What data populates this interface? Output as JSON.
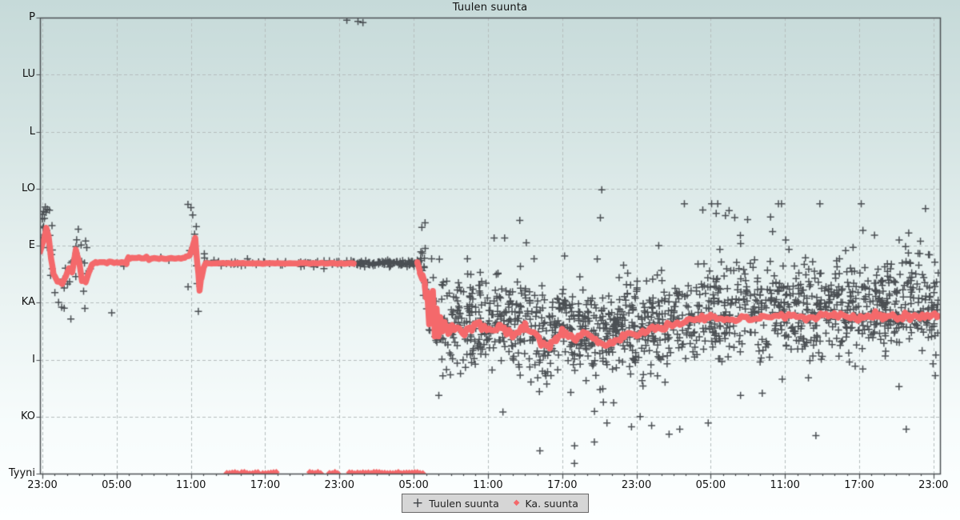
{
  "chart_data": {
    "type": "scatter",
    "title": "Tuulen suunta",
    "legend_position": "bottom-center",
    "grid": {
      "style": "dashed",
      "h_degrees": [
        315,
        270,
        225,
        180,
        135,
        90,
        45
      ],
      "v_hours": [
        0,
        6,
        12,
        18,
        24,
        30,
        36,
        42,
        48,
        54,
        60,
        66,
        72
      ]
    },
    "x_axis": {
      "unit": "time",
      "range_hours": [
        -0.19,
        72.55
      ],
      "tick_hours": [
        0,
        6,
        12,
        18,
        24,
        30,
        36,
        42,
        48,
        54,
        60,
        66,
        72
      ],
      "tick_labels": [
        "23:00",
        "05:00",
        "11:00",
        "17:00",
        "23:00",
        "05:00",
        "11:00",
        "17:00",
        "23:00",
        "05:00",
        "11:00",
        "17:00",
        "23:00"
      ],
      "minor_tick_hours": 1
    },
    "y_axis": {
      "unit": "wind direction, compass points (degrees), Tyyni = calm",
      "range_degrees": [
        0,
        360
      ],
      "tick_degrees": [
        360,
        315,
        270,
        225,
        180,
        135,
        90,
        45,
        0
      ],
      "tick_labels": [
        "P",
        "LU",
        "L",
        "LO",
        "E",
        "KA",
        "I",
        "KO",
        "Tyyni"
      ]
    },
    "series": [
      {
        "name": "Tuulen suunta",
        "marker": "plus",
        "color": "#3d4145",
        "generated_segments": [
          {
            "t0": -0.15,
            "t1": 0.9,
            "n": 16,
            "sd": 20,
            "bias": 6
          },
          {
            "t0": 0.9,
            "t1": 3.6,
            "n": 26,
            "sd": 15,
            "bias": 2
          },
          {
            "t0": 3.6,
            "t1": 11.6,
            "n": 4,
            "sd": 3,
            "bias": 0
          },
          {
            "t0": 11.7,
            "t1": 13.1,
            "n": 9,
            "sd": 26,
            "bias": 4
          },
          {
            "t0": 13.0,
            "t1": 25.15,
            "n": 60,
            "sd": 1.4,
            "bias": 0,
            "center": 166
          },
          {
            "t0": 25.15,
            "t1": 30.45,
            "n": 90,
            "sd": 1.1,
            "bias": 0,
            "center": 166
          },
          {
            "t0": 30.5,
            "t1": 33.0,
            "n": 60,
            "sd": 21,
            "bias": 4
          },
          {
            "t0": 33.0,
            "t1": 72.4,
            "n": 1500,
            "sd": 18,
            "bias": 6,
            "tail_frac": 0.09,
            "tail_sd": 44
          }
        ],
        "outlier_points": [
          [
            0.1,
            207
          ],
          [
            0.0,
            201
          ],
          [
            0.35,
            192
          ],
          [
            0.6,
            188
          ],
          [
            2.3,
            122
          ],
          [
            5.6,
            127
          ],
          [
            2.9,
            193
          ],
          [
            12.0,
            210
          ],
          [
            12.3,
            189
          ],
          [
            12.5,
            150
          ],
          [
            12.6,
            128
          ],
          [
            11.9,
            176
          ],
          [
            24.6,
            358
          ],
          [
            25.5,
            357
          ],
          [
            25.9,
            356
          ],
          [
            36.5,
            186
          ],
          [
            45.2,
            224
          ],
          [
            43.0,
            22
          ],
          [
            47.6,
            37
          ],
          [
            40.2,
            18
          ],
          [
            44.6,
            25
          ],
          [
            48.3,
            45
          ],
          [
            49.8,
            180
          ],
          [
            51.5,
            35
          ],
          [
            53.8,
            40
          ],
          [
            56.4,
            188
          ],
          [
            59.0,
            191
          ],
          [
            62.5,
            30
          ],
          [
            66.3,
            192
          ],
          [
            69.8,
            35
          ],
          [
            70.0,
            190
          ]
        ]
      },
      {
        "name": "Ka. suunta",
        "marker": "diamond",
        "color": "#f4696b",
        "line_parts": [
          [
            [
              -0.19,
              176
            ],
            [
              0.15,
              185
            ],
            [
              0.32,
              194
            ],
            [
              0.5,
              188
            ],
            [
              0.7,
              170
            ],
            [
              0.9,
              158
            ],
            [
              1.2,
              152
            ],
            [
              1.6,
              150
            ],
            [
              1.9,
              156
            ],
            [
              2.15,
              162
            ],
            [
              2.4,
              158
            ],
            [
              2.7,
              177
            ],
            [
              2.95,
              168
            ],
            [
              3.2,
              152
            ],
            [
              3.5,
              151
            ],
            [
              3.75,
              158
            ],
            [
              4.0,
              165
            ],
            [
              4.3,
              166.5
            ],
            [
              6.8,
              166.5
            ],
            [
              6.95,
              170
            ],
            [
              11.5,
              170
            ],
            [
              11.9,
              172
            ],
            [
              12.1,
              178
            ],
            [
              12.35,
              186
            ],
            [
              12.5,
              168
            ],
            [
              12.7,
              146
            ],
            [
              12.85,
              155
            ],
            [
              13.0,
              162
            ],
            [
              13.2,
              166
            ],
            [
              25.15,
              166
            ]
          ],
          [
            [
              30.3,
              166
            ],
            [
              30.5,
              160
            ],
            [
              30.7,
              155
            ],
            [
              30.9,
              149
            ],
            [
              31.0,
              137
            ],
            [
              31.1,
              144
            ],
            [
              31.25,
              116
            ],
            [
              31.4,
              127
            ],
            [
              31.55,
              145
            ],
            [
              31.7,
              110
            ],
            [
              31.85,
              130
            ],
            [
              32.0,
              107
            ],
            [
              32.15,
              122
            ],
            [
              32.3,
              112
            ],
            [
              32.5,
              120
            ],
            [
              32.8,
              110
            ],
            [
              33.0,
              116
            ],
            [
              34,
              112
            ],
            [
              35,
              118
            ],
            [
              36,
              113
            ],
            [
              37,
              116
            ],
            [
              38,
              110
            ],
            [
              39,
              114
            ],
            [
              40,
              108
            ],
            [
              41,
              101
            ],
            [
              41.5,
              106
            ],
            [
              42,
              113
            ],
            [
              43,
              107
            ],
            [
              44,
              111
            ],
            [
              45,
              105
            ],
            [
              46,
              103
            ],
            [
              47,
              109
            ],
            [
              48,
              110
            ],
            [
              50,
              115
            ],
            [
              52,
              120
            ],
            [
              54,
              124
            ],
            [
              56,
              122
            ],
            [
              58,
              123
            ],
            [
              60,
              124
            ],
            [
              62,
              123
            ],
            [
              64,
              125
            ],
            [
              66,
              123
            ],
            [
              68,
              125
            ],
            [
              70,
              124
            ],
            [
              72.35,
              125
            ]
          ]
        ],
        "line_jitter": [
          {
            "t0": -0.2,
            "t1": 13,
            "sd": 1.0
          },
          {
            "t0": 13,
            "t1": 25.2,
            "sd": 0.35
          },
          {
            "t0": 30.2,
            "t1": 33,
            "sd": 2.0
          },
          {
            "t0": 33,
            "t1": 48,
            "sd": 3.2
          },
          {
            "t0": 48,
            "t1": 72.4,
            "sd": 2.2
          }
        ],
        "calm_segments_hours": [
          [
            14.9,
            15.8
          ],
          [
            16.1,
            17.5
          ],
          [
            17.8,
            19.0
          ],
          [
            21.6,
            22.6
          ],
          [
            23.2,
            23.9
          ],
          [
            24.8,
            30.8
          ]
        ]
      }
    ],
    "colors": {
      "observation_marker": "#3d4145",
      "average_line": "#f4696b",
      "grid_line": "#b5bdbd",
      "axis_border": "#4c5154",
      "background_top": "#c6dad9",
      "background_bottom": "#fdffff",
      "legend_background": "#d6d6d6"
    }
  }
}
